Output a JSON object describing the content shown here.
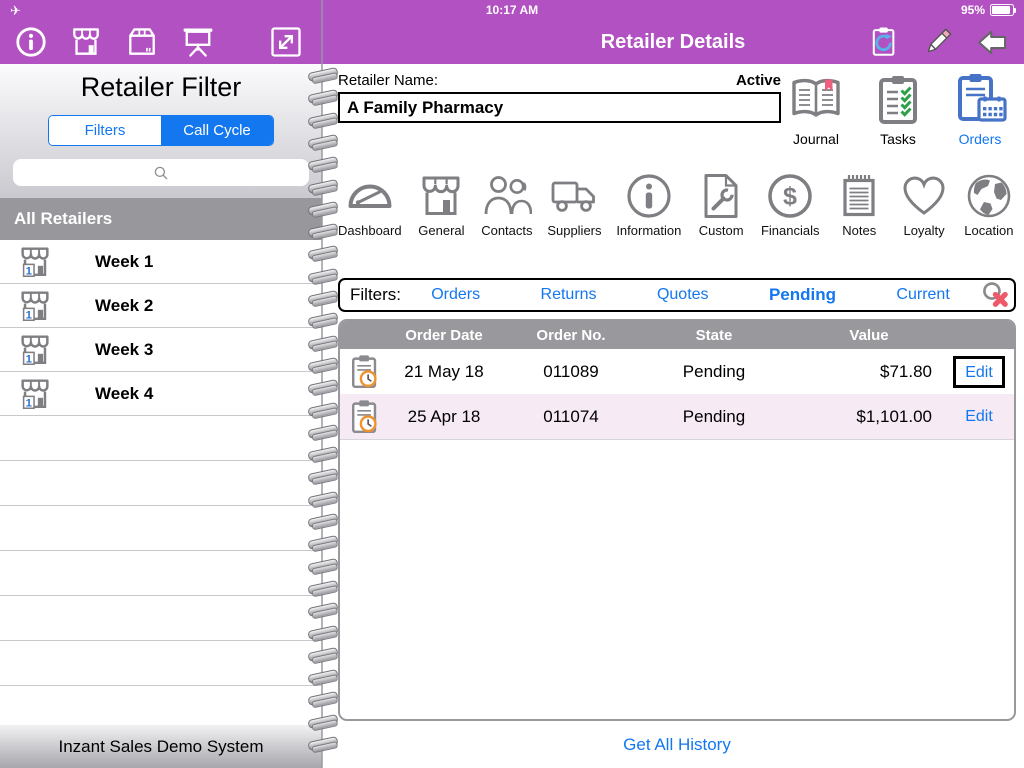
{
  "status_bar": {
    "time": "10:17 AM",
    "battery_percent": "95%",
    "icons": [
      "airplane-icon",
      "battery-icon"
    ]
  },
  "header": {
    "title": "Retailer Details",
    "left_icons": [
      "info-icon",
      "store-icon",
      "package-icon",
      "presentation-icon",
      "expand-icon"
    ],
    "right_icons": [
      "sync-clipboard-icon",
      "pencil-icon",
      "back-arrow-icon"
    ]
  },
  "sidebar": {
    "title": "Retailer Filter",
    "tabs": {
      "filters": "Filters",
      "call_cycle": "Call Cycle",
      "selected": "Call Cycle"
    },
    "search": {
      "placeholder": "",
      "icon": "search-icon"
    },
    "group_header": "All Retailers",
    "weeks": [
      "Week 1",
      "Week 2",
      "Week 3",
      "Week 4"
    ],
    "week_icon": "store-one-icon",
    "footer": "Inzant Sales Demo System"
  },
  "retailer": {
    "name_label": "Retailer Name:",
    "status": "Active",
    "name_value": "A Family Pharmacy"
  },
  "quick_actions": [
    {
      "label": "Journal",
      "icon": "journal-icon"
    },
    {
      "label": "Tasks",
      "icon": "tasks-icon"
    },
    {
      "label": "Orders",
      "icon": "orders-icon",
      "selected": true
    }
  ],
  "nav_tabs": [
    {
      "label": "Dashboard",
      "icon": "dashboard-gauge-icon"
    },
    {
      "label": "General",
      "icon": "general-store-icon"
    },
    {
      "label": "Contacts",
      "icon": "contacts-icon"
    },
    {
      "label": "Suppliers",
      "icon": "suppliers-truck-icon"
    },
    {
      "label": "Information",
      "icon": "information-icon"
    },
    {
      "label": "Custom",
      "icon": "custom-doc-wrench-icon"
    },
    {
      "label": "Financials",
      "icon": "financials-dollar-icon"
    },
    {
      "label": "Notes",
      "icon": "notes-notepad-icon"
    },
    {
      "label": "Loyalty",
      "icon": "loyalty-heart-icon"
    },
    {
      "label": "Location",
      "icon": "location-globe-icon"
    }
  ],
  "filters_bar": {
    "label": "Filters:",
    "options": [
      "Orders",
      "Returns",
      "Quotes",
      "Pending",
      "Current"
    ],
    "selected": "Pending",
    "clear_icon": "clear-search-icon"
  },
  "orders_table": {
    "columns": [
      "Order Date",
      "Order No.",
      "State",
      "Value"
    ],
    "row_icon": "clipboard-clock-icon",
    "rows": [
      {
        "date": "21 May 18",
        "order_no": "011089",
        "state": "Pending",
        "value": "$71.80",
        "action": "Edit",
        "focused": true
      },
      {
        "date": "25 Apr 18",
        "order_no": "011074",
        "state": "Pending",
        "value": "$1,101.00",
        "action": "Edit",
        "focused": false
      }
    ]
  },
  "footer_link": "Get All History",
  "colors": {
    "header_purple": "#b251c1",
    "link_blue": "#1377f0",
    "icon_gray": "#7e7e83",
    "table_header_gray": "#98989d",
    "alt_row_pink": "#f6eaf5",
    "orders_icon_blue": "#4673c8",
    "check_green": "#2ea04a",
    "bookmark_pink": "#ef5e7e",
    "clock_orange": "#f0922e",
    "clear_red": "#ee5a6a"
  }
}
